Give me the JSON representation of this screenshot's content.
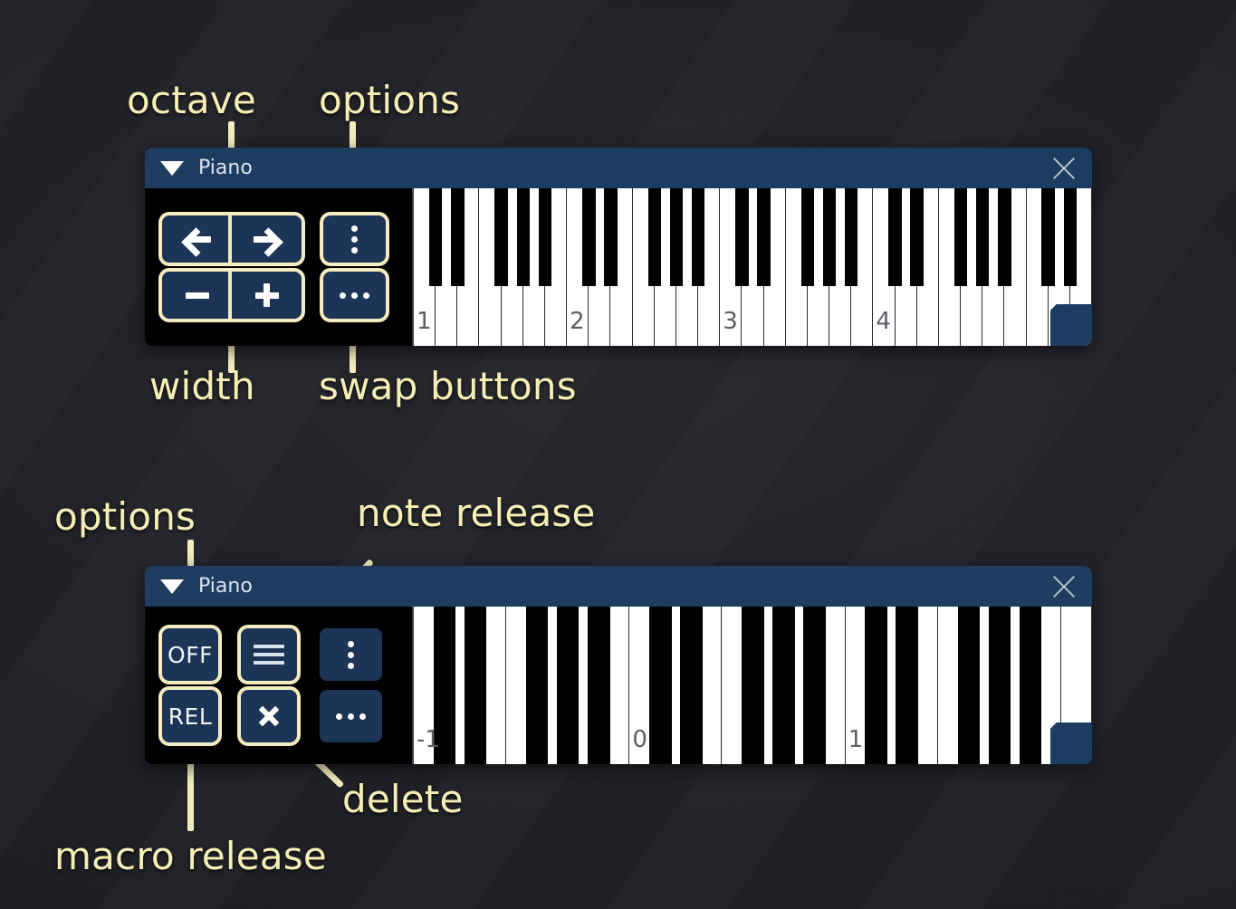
{
  "theme": {
    "background": "#212429",
    "annotation_color": "#f7eeb6",
    "titlebar_color": "#1e3b60",
    "button_color": "#1c3557",
    "highlight_color": "#f4ecbe",
    "key_white": "#ffffff",
    "key_black": "#000000",
    "octave_label_color": "#5b5f63"
  },
  "annotations": [
    {
      "id": "octave",
      "text": "octave"
    },
    {
      "id": "options_top",
      "text": "options"
    },
    {
      "id": "width",
      "text": "width"
    },
    {
      "id": "swap_buttons",
      "text": "swap buttons"
    },
    {
      "id": "options_bottom",
      "text": "options"
    },
    {
      "id": "note_release",
      "text": "note release"
    },
    {
      "id": "delete",
      "text": "delete"
    },
    {
      "id": "macro_release",
      "text": "macro release"
    }
  ],
  "widgets": [
    {
      "id": "piano-wide",
      "title": "Piano",
      "collapse_icon": "triangle-down-icon",
      "close_icon": "close-icon",
      "buttons": [
        {
          "id": "octave-down",
          "icon": "arrow-left-icon",
          "label": "",
          "highlighted": true
        },
        {
          "id": "octave-up",
          "icon": "arrow-right-icon",
          "label": "",
          "highlighted": true
        },
        {
          "id": "options",
          "icon": "dots-vertical-icon",
          "label": "",
          "highlighted": true
        },
        {
          "id": "width-down",
          "icon": "minus-icon",
          "label": "",
          "highlighted": true
        },
        {
          "id": "width-up",
          "icon": "plus-icon",
          "label": "",
          "highlighted": true
        },
        {
          "id": "swap-buttons",
          "icon": "dots-horizontal-icon",
          "label": "",
          "highlighted": false
        }
      ],
      "keyboard": {
        "mode": "standard",
        "octave_labels": [
          "1",
          "2",
          "3",
          "4"
        ],
        "white_keys": 31,
        "start_note": "C"
      }
    },
    {
      "id": "piano-narrow",
      "title": "Piano",
      "collapse_icon": "triangle-down-icon",
      "close_icon": "close-icon",
      "buttons": [
        {
          "id": "macro-off",
          "icon": "",
          "label": "OFF",
          "highlighted": true
        },
        {
          "id": "note-release",
          "icon": "equals-icon",
          "label": "",
          "highlighted": true
        },
        {
          "id": "options",
          "icon": "dots-vertical-icon",
          "label": "",
          "highlighted": false
        },
        {
          "id": "macro-rel",
          "icon": "",
          "label": "REL",
          "highlighted": true
        },
        {
          "id": "delete",
          "icon": "close-bold-icon",
          "label": "",
          "highlighted": true
        },
        {
          "id": "swap-buttons",
          "icon": "dots-horizontal-icon",
          "label": "",
          "highlighted": false
        }
      ],
      "keyboard": {
        "mode": "narrow",
        "octave_labels": [
          "-1",
          "0",
          "1"
        ],
        "white_keys": 22,
        "start_note": "C"
      }
    }
  ]
}
